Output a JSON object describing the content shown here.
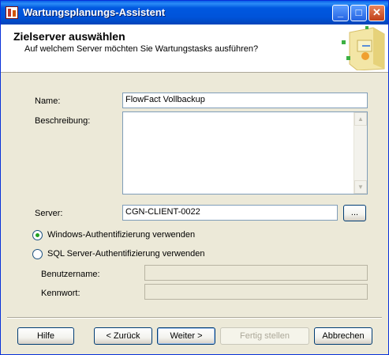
{
  "window": {
    "title": "Wartungsplanungs-Assistent",
    "controls": {
      "minimize": "_",
      "maximize": "□",
      "close": "✕"
    }
  },
  "header": {
    "title": "Zielserver auswählen",
    "subtitle": "Auf welchem Server möchten Sie Wartungstasks ausführen?"
  },
  "form": {
    "name_label": "Name:",
    "name_value": "FlowFact Vollbackup",
    "description_label": "Beschreibung:",
    "description_value": "",
    "server_label": "Server:",
    "server_value": "CGN-CLIENT-0022",
    "browse_label": "...",
    "auth_windows_label": "Windows-Authentifizierung verwenden",
    "auth_windows_selected": true,
    "auth_sql_label": "SQL Server-Authentifizierung verwenden",
    "auth_sql_selected": false,
    "username_label": "Benutzername:",
    "username_value": "",
    "password_label": "Kennwort:",
    "password_value": ""
  },
  "footer": {
    "help": "Hilfe",
    "back": "< Zurück",
    "next": "Weiter >",
    "finish": "Fertig stellen",
    "cancel": "Abbrechen"
  },
  "colors": {
    "titlebar": "#0058e0",
    "dialog_bg": "#ece9d8",
    "radio_dot": "#21a121"
  }
}
